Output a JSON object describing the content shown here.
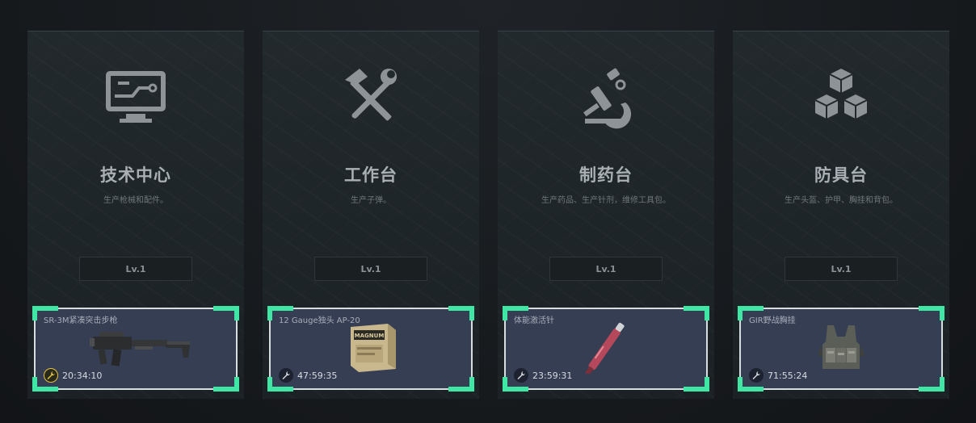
{
  "stations": [
    {
      "icon": "computer-monitor-icon",
      "title": "技术中心",
      "description": "生产枪械和配件。",
      "level": "Lv.1",
      "production": {
        "item_name": "SR-3M紧凑突击步枪",
        "item_icon": "assault-rifle-image",
        "timer": "20:34:10",
        "timer_icon": "wrench-progress-icon"
      }
    },
    {
      "icon": "hammer-wrench-icon",
      "title": "工作台",
      "description": "生产子弹。",
      "level": "Lv.1",
      "production": {
        "item_name": "12 Gauge独头 AP-20",
        "item_icon": "ammo-box-image",
        "timer": "47:59:35",
        "timer_icon": "wrench-icon"
      }
    },
    {
      "icon": "microscope-icon",
      "title": "制药台",
      "description": "生产药品、生产针剂，维修工具包。",
      "level": "Lv.1",
      "production": {
        "item_name": "体能激活针",
        "item_icon": "stimulant-injector-image",
        "timer": "23:59:31",
        "timer_icon": "wrench-icon"
      }
    },
    {
      "icon": "stacked-cubes-icon",
      "title": "防具台",
      "description": "生产头盔、护甲、胸挂和背包。",
      "level": "Lv.1",
      "production": {
        "item_name": "GIR野战胸挂",
        "item_icon": "chest-rig-image",
        "timer": "71:55:24",
        "timer_icon": "wrench-icon"
      }
    }
  ],
  "colors": {
    "accent_corner": "#3fe6a4",
    "card_bg": "#363e54",
    "title_text": "#a9b0b4"
  }
}
